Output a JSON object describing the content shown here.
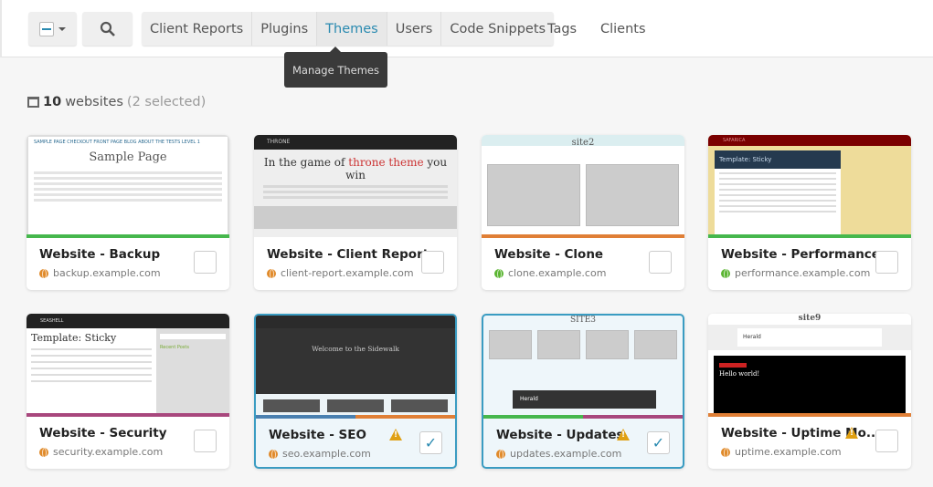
{
  "toolbar": {
    "select_icon": "minus-checkbox-dropdown",
    "search_icon": "search-icon",
    "tabs": [
      {
        "label": "Client Reports"
      },
      {
        "label": "Plugins"
      },
      {
        "label": "Themes",
        "active": true
      },
      {
        "label": "Users"
      },
      {
        "label": "Code Snippets"
      }
    ],
    "links": [
      {
        "label": "Tags"
      },
      {
        "label": "Clients"
      }
    ],
    "tooltip": "Manage Themes"
  },
  "summary": {
    "count": "10",
    "label": "websites",
    "selected": "(2 selected)"
  },
  "colors": {
    "accent": "#2a8ab0",
    "green": "#46b74d",
    "orange": "#e07f36",
    "purple": "#a8477d",
    "blue": "#4a80b0",
    "warning": "#e0a012"
  },
  "sites": [
    {
      "name": "Website - Backup",
      "url": "backup.example.com",
      "globe": "#e08a2a",
      "bars": [
        "#46b74d"
      ],
      "selected": false,
      "warning": false,
      "thumb": {
        "title": "Sample Page",
        "nav": "SAMPLE PAGE  CHECKOUT  FRONT PAGE  BLOG  ABOUT THE TESTS  LEVEL 1"
      }
    },
    {
      "name": "Website - Client Report",
      "url": "client-report.example.com",
      "globe": "#e08a2a",
      "bars": [],
      "selected": false,
      "warning": false,
      "thumb": {
        "logo": "THRONE",
        "title_a": "In the game of ",
        "title_b": "throne theme",
        "title_c": " you win"
      }
    },
    {
      "name": "Website - Clone",
      "url": "clone.example.com",
      "globe": "#5bb532",
      "bars": [
        "#e07f36"
      ],
      "selected": false,
      "warning": false,
      "thumb": {
        "title": "site2"
      }
    },
    {
      "name": "Website - Performance",
      "url": "performance.example.com",
      "globe": "#5bb532",
      "bars": [
        "#46b74d"
      ],
      "selected": false,
      "warning": false,
      "thumb": {
        "logo": "SAFARICA",
        "title": "Template: Sticky"
      }
    },
    {
      "name": "Website - Security",
      "url": "security.example.com",
      "globe": "#e08a2a",
      "bars": [
        "#a8477d"
      ],
      "selected": false,
      "warning": false,
      "thumb": {
        "logo": "SEASHELL",
        "title": "Template: Sticky",
        "side": "Recent Posts"
      }
    },
    {
      "name": "Website - SEO",
      "url": "seo.example.com",
      "globe": "#e08a2a",
      "bars": [
        "#4a80b0",
        "#e07f36"
      ],
      "selected": true,
      "warning": true,
      "thumb": {
        "title": "Welcome to the Sidewalk"
      }
    },
    {
      "name": "Website - Updates",
      "url": "updates.example.com",
      "globe": "#e08a2a",
      "bars": [
        "#46b74d",
        "#a8477d"
      ],
      "selected": true,
      "warning": true,
      "thumb": {
        "title": "SITE3",
        "ad": "Herald"
      }
    },
    {
      "name": "Website - Uptime Mo...",
      "url": "uptime.example.com",
      "globe": "#e08a2a",
      "bars": [
        "#e07f36"
      ],
      "selected": false,
      "warning": true,
      "thumb": {
        "title": "site9",
        "ad": "Herald",
        "post": "Hello world!"
      }
    }
  ]
}
